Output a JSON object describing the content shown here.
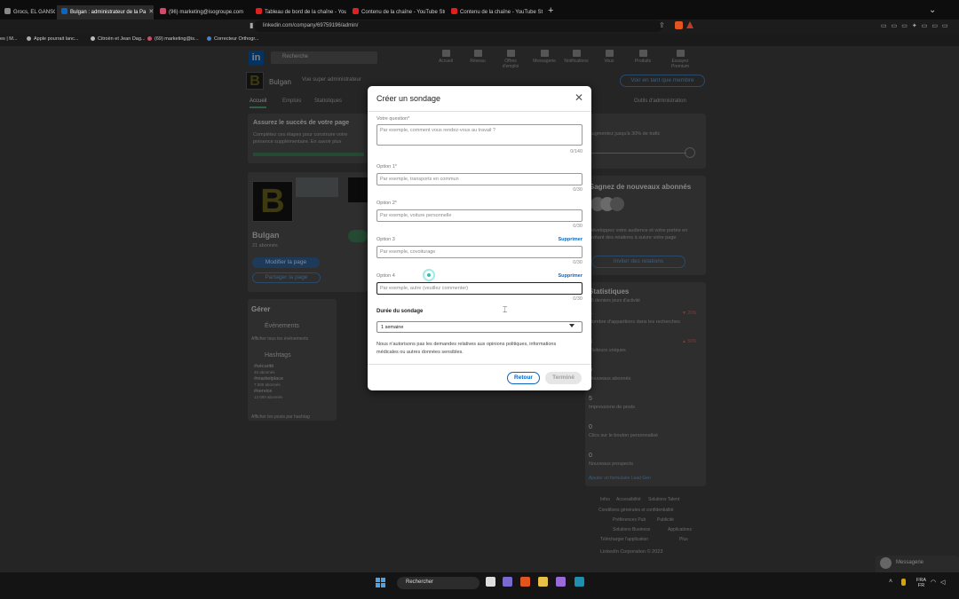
{
  "browser": {
    "tabs": [
      {
        "label": "Grocs, EL GANSO, Freep",
        "active": false,
        "color": "#888888"
      },
      {
        "label": "Bulgan : administrateur de la Pa",
        "active": true,
        "color": "#0a66c2"
      },
      {
        "label": "(96) marketing@isogroupe.com",
        "active": false,
        "color": "#d04a6a"
      },
      {
        "label": "Tableau de bord de la chaîne - YouTube",
        "active": false,
        "color": "#e02020"
      },
      {
        "label": "Contenu de la chaîne - YouTube Studi",
        "active": false,
        "color": "#e02020"
      },
      {
        "label": "Contenu de la chaîne - YouTube Studi",
        "active": false,
        "color": "#e02020"
      }
    ],
    "new_tab": "+",
    "url": "linkedin.com/company/69759196/admin/",
    "bookmarks": [
      {
        "label": "es | M...",
        "color": "#777777"
      },
      {
        "label": "Apple pourrait lanc...",
        "color": "#aaaaaa"
      },
      {
        "label": "Citroën et Jean Dag...",
        "color": "#bbbbbb"
      },
      {
        "label": "(69) marketing@is...",
        "color": "#d04a6a"
      },
      {
        "label": "Correcteur Orthogr...",
        "color": "#4a7fd0"
      }
    ]
  },
  "linkedin": {
    "logo": "in",
    "search_placeholder": "Recherche",
    "nav": [
      "Accueil",
      "Réseau",
      "Offres d'emploi",
      "Messagerie",
      "Notifications",
      "Vous",
      "Produits",
      "Essayez Premium"
    ],
    "company_logo": "B",
    "company_name": "Bulgan",
    "company_subtitle": "Vue super administrateur",
    "view_as_member": "Voir en tant que membre",
    "page_tabs": [
      "Accueil",
      "Emplois",
      "Statistiques"
    ],
    "admin_tools": "Outils d'administration",
    "success_title": "Assurez le succès de votre page",
    "success_text": "Complétez ces étapes pour construire votre présence supplémentaire. En savoir plus",
    "followers_name": "Bulgan",
    "followers_count": "21 abonnés",
    "edit_page": "Modifier la page",
    "share_page": "Partager la page",
    "manage": "Gérer",
    "events": "Événements",
    "events_empty": "Afficher tous les événements",
    "hashtags": "Hashtags",
    "hashtag_list": [
      {
        "tag": "#sécurité",
        "count": "45 abonnés"
      },
      {
        "tag": "#marketplace",
        "count": "7 000 abonnés"
      },
      {
        "tag": "#service",
        "count": "13 000 abonnés"
      }
    ],
    "hashtags_note": "Afficher les posts par hashtag",
    "boost_text": "Augmentez jusqu'à 30% de trafic",
    "new_followers_title": "Gagnez de nouveaux abonnés",
    "new_followers_text": "Développez votre audience et votre portée en invitant des relations à suivre votre page",
    "invite_button": "Inviter des relations",
    "stats_title": "Statistiques",
    "stats_sub": "30 derniers jours d'activité",
    "stats": [
      {
        "label": "Nombre d'apparitions dans les recherches",
        "value": "4",
        "delta": "▼ 20%"
      },
      {
        "label": "Visiteurs uniques",
        "value": "3",
        "delta": "▲ 50%"
      },
      {
        "label": "Nouveaux abonnés",
        "value": "0",
        "delta": ""
      },
      {
        "label": "Impressions de posts",
        "value": "5",
        "delta": ""
      },
      {
        "label": "Clics sur le bouton personnalisé",
        "value": "0",
        "delta": ""
      },
      {
        "label": "Nouveaux prospects",
        "value": "0",
        "delta": ""
      }
    ],
    "lead_gen": "Ajouter un formulaire Lead Gen",
    "footer_links": [
      "Infos",
      "Accessibilité",
      "Solutions Talent",
      "Conditions générales et confidentialité",
      "Préférences Pub",
      "Publicité",
      "Solutions Business",
      "Applications",
      "Télécharger l'application",
      "Plus"
    ],
    "copyright": "LinkedIn Corporation © 2023",
    "messaging": "Messagerie"
  },
  "modal": {
    "title": "Créer un sondage",
    "question_label": "Votre question*",
    "question_placeholder": "Par exemple, comment vous rendez-vous au travail ?",
    "question_counter": "0/140",
    "options": [
      {
        "label": "Option 1*",
        "placeholder": "Par exemple, transports en commun",
        "counter": "0/30",
        "removable": false,
        "focused": false
      },
      {
        "label": "Option 2*",
        "placeholder": "Par exemple, voiture personnelle",
        "counter": "0/30",
        "removable": false,
        "focused": false
      },
      {
        "label": "Option 3",
        "placeholder": "Par exemple, covoiturage",
        "counter": "0/30",
        "removable": true,
        "focused": false
      },
      {
        "label": "Option 4",
        "placeholder": "Par exemple, autre (veuillez commenter)",
        "counter": "0/30",
        "removable": true,
        "focused": true
      }
    ],
    "remove_label": "Supprimer",
    "duration_label": "Durée du sondage",
    "duration_value": "1 semaine",
    "note": "Nous n'autorisons pas les demandes relatives aux opinions politiques, informations médicales ou autres données sensibles.",
    "back_button": "Retour",
    "done_button": "Terminé"
  },
  "taskbar": {
    "search": "Rechercher",
    "lang_top": "FRA",
    "lang_bottom": "FR",
    "icons": [
      "files-icon",
      "chat-icon",
      "brave-icon",
      "folder-icon",
      "notepad-icon",
      "terminal-icon"
    ]
  }
}
